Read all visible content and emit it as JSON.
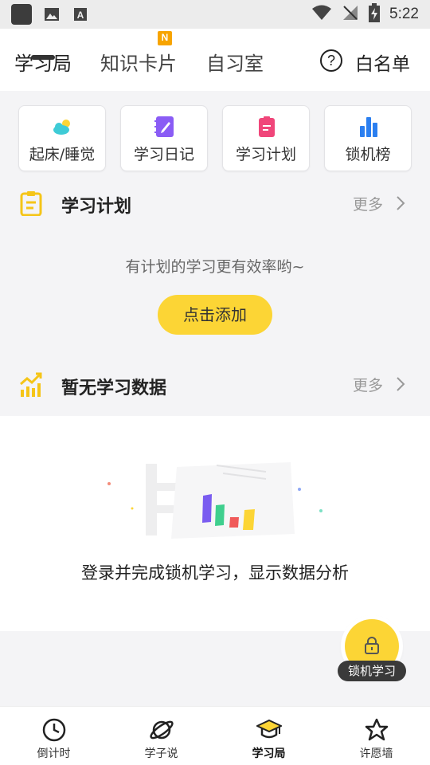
{
  "status_bar": {
    "time": "5:22",
    "icons": [
      "app-icon",
      "image-icon",
      "font-icon",
      "wifi-icon",
      "signal-off-icon",
      "battery-icon"
    ]
  },
  "top_tabs": {
    "tabs": [
      {
        "label": "学习局",
        "active": true
      },
      {
        "label": "知识卡片",
        "badge": "N"
      },
      {
        "label": "自习室"
      }
    ],
    "help_icon": "help-icon",
    "whitelist_label": "白名单"
  },
  "shortcuts": [
    {
      "label": "起床/睡觉",
      "icon": "weather-icon"
    },
    {
      "label": "学习日记",
      "icon": "notebook-icon"
    },
    {
      "label": "学习计划",
      "icon": "clipboard-icon"
    },
    {
      "label": "锁机榜",
      "icon": "bar-chart-icon"
    }
  ],
  "plan_section": {
    "title": "学习计划",
    "more": "更多",
    "hint": "有计划的学习更有效率哟~",
    "add_button": "点击添加"
  },
  "data_section": {
    "title": "暂无学习数据",
    "more": "更多",
    "empty_text": "登录并完成锁机学习，显示数据分析"
  },
  "lock_fab": {
    "label": "锁机学习"
  },
  "bottom_nav": [
    {
      "label": "倒计时",
      "icon": "clock-icon"
    },
    {
      "label": "学子说",
      "icon": "planet-icon"
    },
    {
      "label": "学习局",
      "icon": "graduation-cap-icon",
      "active": true
    },
    {
      "label": "许愿墙",
      "icon": "star-icon"
    }
  ],
  "colors": {
    "accent_yellow": "#fcd535",
    "badge_orange": "#f7a400",
    "weather_teal": "#3ecbd6",
    "notebook_purple": "#8a5cf5",
    "clipboard_pink": "#f0467a",
    "chart_blue": "#2b7ff0"
  }
}
